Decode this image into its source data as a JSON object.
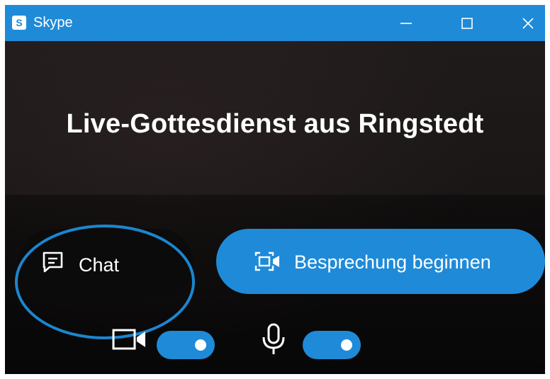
{
  "window": {
    "title": "Skype",
    "logo_letter": "S",
    "controls": [
      "minimize",
      "maximize",
      "close"
    ]
  },
  "meeting": {
    "title": "Live-Gottesdienst aus Ringstedt"
  },
  "actions": {
    "chat_label": "Chat",
    "start_label": "Besprechung beginnen"
  },
  "toggles": {
    "video_on": true,
    "audio_on": true
  },
  "icons": {
    "chat": "chat-icon",
    "start": "video-call-icon",
    "camera": "camera-icon",
    "mic": "microphone-icon"
  },
  "colors": {
    "accent": "#1f8ad8",
    "background": "#1b1818",
    "highlight_ring": "#1b86d0",
    "text": "#ffffff"
  }
}
